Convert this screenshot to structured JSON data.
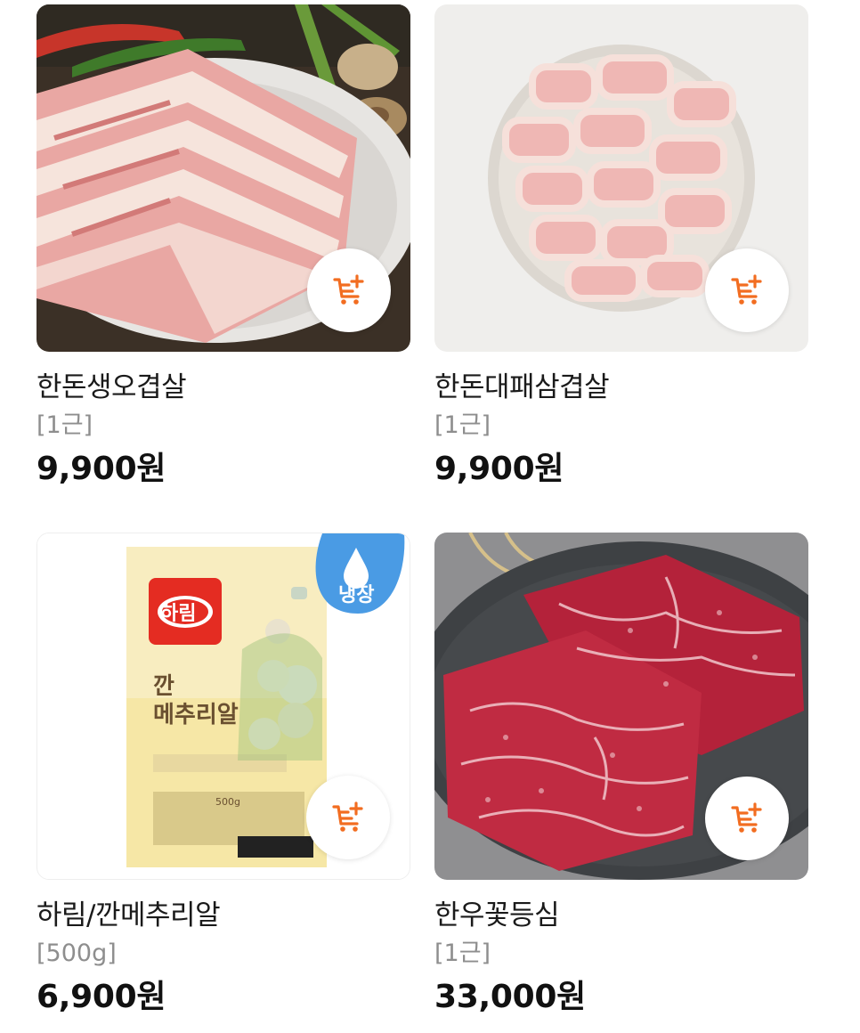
{
  "colors": {
    "accent": "#f26d21",
    "price_text": "#111111",
    "unit_text": "#8e8e8e"
  },
  "products": [
    {
      "name": "한돈생오겹살",
      "unit": "[1근]",
      "price": "9,900원",
      "image": "pork-belly-on-plate",
      "cart_icon": "add-to-cart-icon"
    },
    {
      "name": "한돈대패삼겹살",
      "unit": "[1근]",
      "price": "9,900원",
      "image": "sliced-pork-rolls-in-bowl",
      "cart_icon": "add-to-cart-icon"
    },
    {
      "name": "하림/깐메추리알",
      "unit": "[500g]",
      "price": "6,900원",
      "image": "quail-egg-package",
      "cart_icon": "add-to-cart-icon",
      "package": {
        "brand": "하림",
        "title_line1": "깐",
        "title_line2": "메추리알",
        "badge": "냉장",
        "weight": "500g"
      }
    },
    {
      "name": "한우꽃등심",
      "unit": "[1근]",
      "price": "33,000원",
      "image": "marbled-beef-on-slate",
      "cart_icon": "add-to-cart-icon"
    }
  ]
}
